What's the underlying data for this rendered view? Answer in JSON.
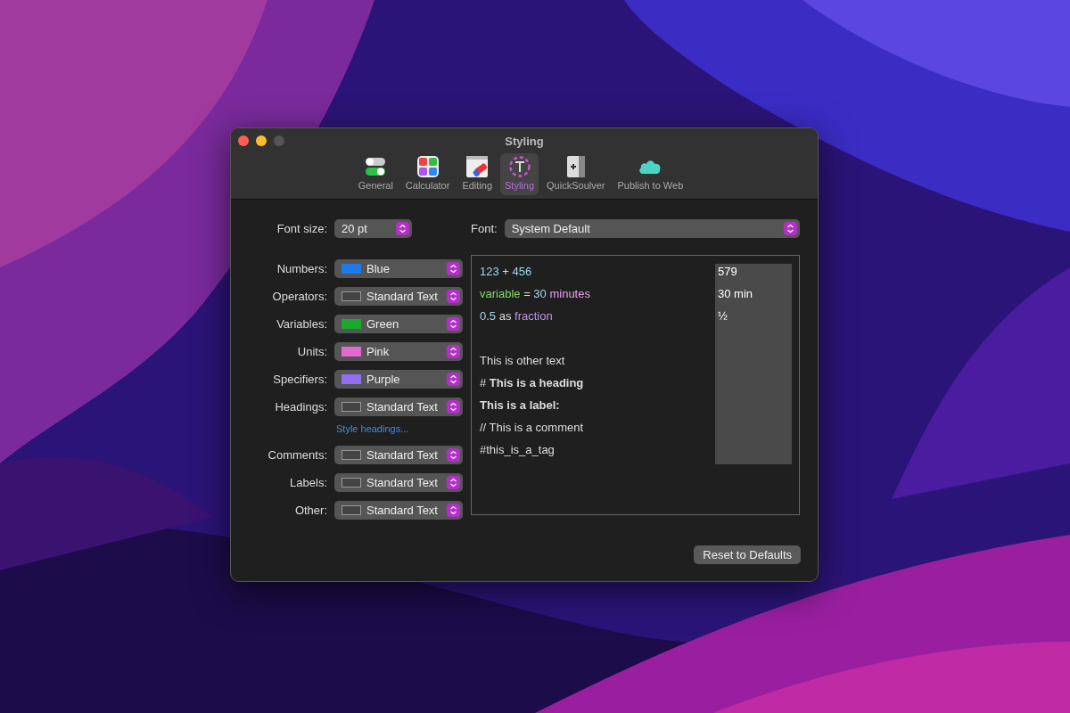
{
  "window": {
    "title": "Styling"
  },
  "tabs": [
    {
      "label": "General",
      "kind": "toggles",
      "selected": false
    },
    {
      "label": "Calculator",
      "kind": "calculator",
      "selected": false
    },
    {
      "label": "Editing",
      "kind": "eraser",
      "selected": false
    },
    {
      "label": "Styling",
      "kind": "styling",
      "selected": true
    },
    {
      "label": "QuickSoulver",
      "kind": "panel",
      "selected": false
    },
    {
      "label": "Publish to Web",
      "kind": "cloud",
      "selected": false
    }
  ],
  "font_size": {
    "label": "Font size:",
    "value": "20 pt"
  },
  "font": {
    "label": "Font:",
    "value": "System Default"
  },
  "style_rows": [
    {
      "label": "Numbers:",
      "value": "Blue",
      "color": "#1e7ae6"
    },
    {
      "label": "Operators:",
      "value": "Standard Text"
    },
    {
      "label": "Variables:",
      "value": "Green",
      "color": "#1aaa2a"
    },
    {
      "label": "Units:",
      "value": "Pink",
      "color": "#e36bd0"
    },
    {
      "label": "Specifiers:",
      "value": "Purple",
      "color": "#8f6ef0"
    },
    {
      "label": "Headings:",
      "value": "Standard Text",
      "link": "Style headings..."
    },
    {
      "label": "Comments:",
      "value": "Standard Text"
    },
    {
      "label": "Labels:",
      "value": "Standard Text"
    },
    {
      "label": "Other:",
      "value": "Standard Text"
    }
  ],
  "preview": {
    "expressions": [
      {
        "segments": [
          {
            "text": "123",
            "kind": "normal",
            "color": "#9fd8ec"
          },
          {
            "text": " + ",
            "kind": "normal"
          },
          {
            "text": "456",
            "kind": "normal",
            "color": "#9fd8ec"
          }
        ],
        "result": "579"
      },
      {
        "segments": [
          {
            "text": "variable",
            "kind": "normal",
            "color": "#86d86e"
          },
          {
            "text": " = ",
            "kind": "normal"
          },
          {
            "text": "30",
            "kind": "normal",
            "color": "#9fd8ec"
          },
          {
            "text": " minutes",
            "kind": "normal",
            "color": "#e7a2ea"
          }
        ],
        "result": "30 min"
      },
      {
        "segments": [
          {
            "text": "0.5",
            "kind": "normal",
            "color": "#9fd8ec"
          },
          {
            "text": " as ",
            "kind": "normal"
          },
          {
            "text": "fraction",
            "kind": "normal",
            "color": "#b994ea"
          }
        ],
        "result": "½"
      }
    ],
    "samples": [
      {
        "segments": [
          {
            "text": "This is other text",
            "kind": "normal"
          }
        ]
      },
      {
        "segments": [
          {
            "text": "# ",
            "kind": "normal"
          },
          {
            "text": "This is a heading",
            "kind": "bold"
          }
        ]
      },
      {
        "segments": [
          {
            "text": "This is a label:",
            "kind": "bold"
          }
        ]
      },
      {
        "segments": [
          {
            "text": "// This is a comment",
            "kind": "normal"
          }
        ]
      },
      {
        "segments": [
          {
            "text": "#this_is_a_tag",
            "kind": "normal"
          }
        ]
      }
    ]
  },
  "reset_button": "Reset to Defaults"
}
